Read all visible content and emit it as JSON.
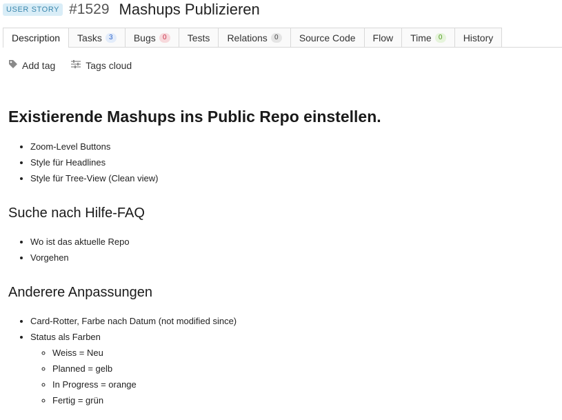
{
  "header": {
    "type_badge": "USER STORY",
    "id": "#1529",
    "title": "Mashups Publizieren"
  },
  "tabs": [
    {
      "label": "Description",
      "count": null
    },
    {
      "label": "Tasks",
      "count": "3"
    },
    {
      "label": "Bugs",
      "count": "0"
    },
    {
      "label": "Tests",
      "count": null
    },
    {
      "label": "Relations",
      "count": "0"
    },
    {
      "label": "Source Code",
      "count": null
    },
    {
      "label": "Flow",
      "count": null
    },
    {
      "label": "Time",
      "count": "0"
    },
    {
      "label": "History",
      "count": null
    }
  ],
  "toolbar": {
    "add_tag": "Add tag",
    "tags_cloud": "Tags cloud"
  },
  "description": {
    "heading1": "Existierende Mashups ins Public Repo einstellen.",
    "list1": [
      "Zoom-Level Buttons",
      "Style für Headlines",
      "Style für Tree-View (Clean view)"
    ],
    "heading2": "Suche nach Hilfe-FAQ",
    "list2": [
      "Wo ist das aktuelle Repo",
      "Vorgehen"
    ],
    "heading3": "Anderere Anpassungen",
    "list3": [
      "Card-Rotter, Farbe nach Datum (not modified since)",
      "Status als Farben"
    ],
    "sublist3": [
      "Weiss = Neu",
      "Planned = gelb",
      "In Progress = orange",
      "Fertig = grün"
    ]
  }
}
